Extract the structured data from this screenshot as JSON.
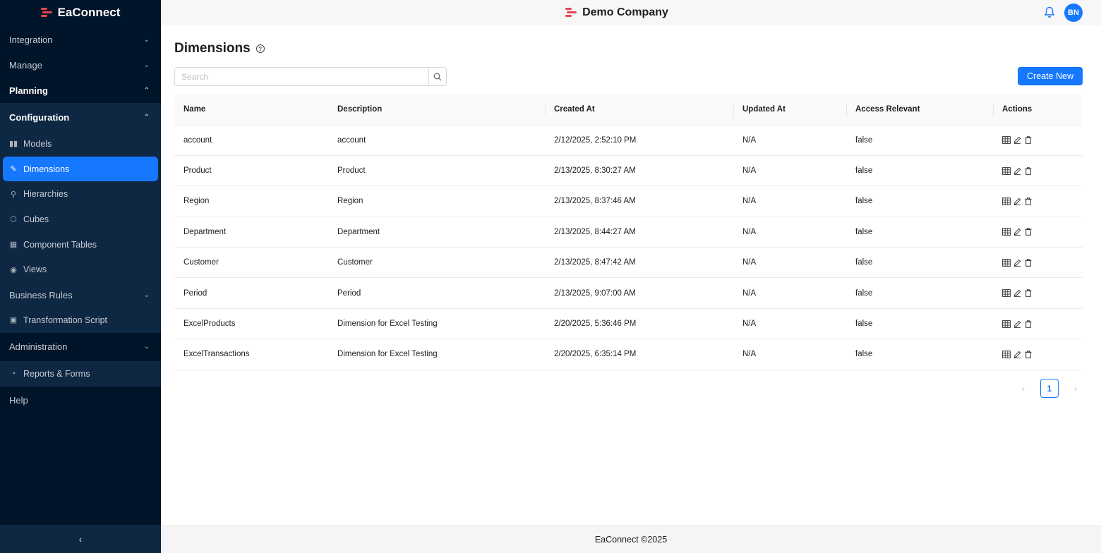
{
  "app": {
    "brand": "EaConnect",
    "company": "Demo Company",
    "avatar_initials": "BN",
    "footer": "EaConnect ©2025"
  },
  "sidebar": {
    "groups": [
      {
        "label": "Integration",
        "expanded": false
      },
      {
        "label": "Manage",
        "expanded": false
      },
      {
        "label": "Planning",
        "expanded": true
      },
      {
        "label": "Configuration",
        "expanded": true
      }
    ],
    "config_items": [
      {
        "label": "Models",
        "icon": "models-icon"
      },
      {
        "label": "Dimensions",
        "icon": "ruler-icon",
        "active": true
      },
      {
        "label": "Hierarchies",
        "icon": "hierarchy-icon"
      },
      {
        "label": "Cubes",
        "icon": "cube-icon"
      },
      {
        "label": "Component Tables",
        "icon": "table-icon"
      },
      {
        "label": "Views",
        "icon": "eye-icon"
      }
    ],
    "business_rules": "Business Rules",
    "transformation_script": "Transformation Script",
    "administration": "Administration",
    "reports_forms": "Reports & Forms",
    "help": "Help"
  },
  "page": {
    "title": "Dimensions",
    "search_placeholder": "Search",
    "create_label": "Create New",
    "columns": [
      "Name",
      "Description",
      "Created At",
      "Updated At",
      "Access Relevant",
      "Actions"
    ],
    "rows": [
      {
        "name": "account",
        "description": "account",
        "created": "2/12/2025, 2:52:10 PM",
        "updated": "N/A",
        "access": "false"
      },
      {
        "name": "Product",
        "description": "Product",
        "created": "2/13/2025, 8:30:27 AM",
        "updated": "N/A",
        "access": "false"
      },
      {
        "name": "Region",
        "description": "Region",
        "created": "2/13/2025, 8:37:46 AM",
        "updated": "N/A",
        "access": "false"
      },
      {
        "name": "Department",
        "description": "Department",
        "created": "2/13/2025, 8:44:27 AM",
        "updated": "N/A",
        "access": "false"
      },
      {
        "name": "Customer",
        "description": "Customer",
        "created": "2/13/2025, 8:47:42 AM",
        "updated": "N/A",
        "access": "false"
      },
      {
        "name": "Period",
        "description": "Period",
        "created": "2/13/2025, 9:07:00 AM",
        "updated": "N/A",
        "access": "false"
      },
      {
        "name": "ExcelProducts",
        "description": "Dimension for Excel Testing",
        "created": "2/20/2025, 5:36:46 PM",
        "updated": "N/A",
        "access": "false"
      },
      {
        "name": "ExcelTransactions",
        "description": "Dimension for Excel Testing",
        "created": "2/20/2025, 6:35:14 PM",
        "updated": "N/A",
        "access": "false"
      }
    ],
    "current_page": "1"
  }
}
